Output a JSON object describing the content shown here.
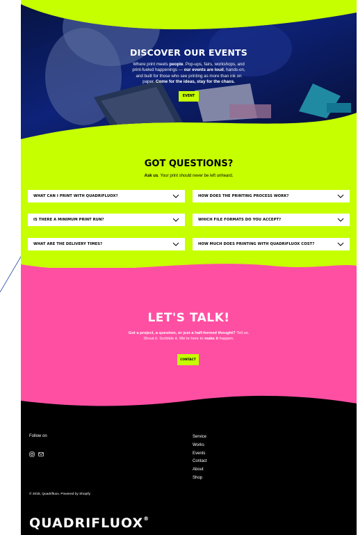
{
  "hero": {
    "title": "DISCOVER OUR EVENTS",
    "desc_1": "Where print meets ",
    "desc_b1": "people",
    "desc_2": ". Pop-ups, fairs, workshops, and print-fueled happenings — ",
    "desc_b2": "our events are loud",
    "desc_3": ", hands-on, and built for those who see printing as more than ink on paper. ",
    "desc_b3": "Come for the ideas, stay for the chaos.",
    "button": "EVENT"
  },
  "faq": {
    "title": "GOT QUESTIONS?",
    "subtitle_bold": "Ask us",
    "subtitle_rest": ". Your print should never be left unheard.",
    "questions": [
      "WHAT CAN I PRINT WITH QUADRIFLUOX?",
      "HOW DOES THE PRINTING PROCESS WORK?",
      "IS THERE A MINIMUM PRINT RUN?",
      "WHICH FILE FORMATS DO YOU ACCEPT?",
      "WHAT ARE THE DELIVERY TIMES?",
      "HOW MUCH DOES PRINTING WITH QUADRIFLUOX COST?"
    ]
  },
  "talk": {
    "title": "LET'S TALK!",
    "desc_b1": "Got a project, a question, or just a half-formed thought?",
    "desc_2": " Tell us. Shout it. Scribble it. We're here to ",
    "desc_b2": "make it",
    "desc_3": " happen.",
    "button": "CONTACT"
  },
  "footer": {
    "follow": "Follow on",
    "icons": [
      "instagram-icon",
      "mail-icon"
    ],
    "nav": [
      "Service",
      "Works",
      "Events",
      "Contact",
      "About",
      "Shop"
    ],
    "copyright": "© 2025, Quadrifluox.  Powered by Shopify",
    "brand": "QUADRIFLUOX",
    "brand_mark": "®"
  },
  "colors": {
    "lime": "#c6ff00",
    "pink": "#ff4fa3",
    "black": "#000000"
  }
}
